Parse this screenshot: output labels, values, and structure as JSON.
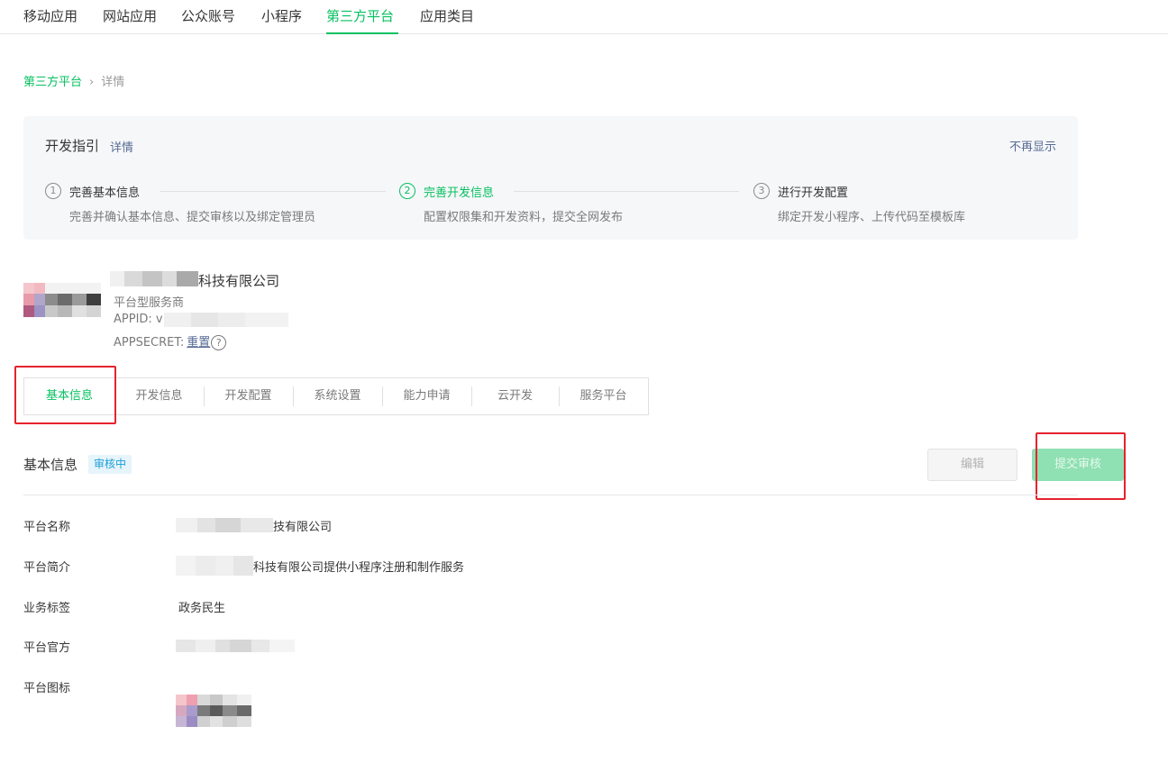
{
  "top_nav": {
    "tabs": [
      {
        "label": "移动应用",
        "active": false
      },
      {
        "label": "网站应用",
        "active": false
      },
      {
        "label": "公众账号",
        "active": false
      },
      {
        "label": "小程序",
        "active": false
      },
      {
        "label": "第三方平台",
        "active": true
      },
      {
        "label": "应用类目",
        "active": false
      }
    ]
  },
  "breadcrumb": {
    "parent": "第三方平台",
    "separator": "›",
    "current": "详情"
  },
  "guide": {
    "title": "开发指引",
    "detail_link": "详情",
    "hide_link": "不再显示",
    "steps": [
      {
        "num": "1",
        "title": "完善基本信息",
        "desc": "完善并确认基本信息、提交审核以及绑定管理员",
        "active": false
      },
      {
        "num": "2",
        "title": "完善开发信息",
        "desc": "配置权限集和开发资料，提交全网发布",
        "active": true
      },
      {
        "num": "3",
        "title": "进行开发配置",
        "desc": "绑定开发小程序、上传代码至模板库",
        "active": false
      }
    ]
  },
  "platform": {
    "name_suffix": "科技有限公司",
    "type": "平台型服务商",
    "appid_label": "APPID: v",
    "appsecret_label": "APPSECRET:",
    "reset_link": "重置",
    "help_icon_glyph": "?"
  },
  "tabs": [
    {
      "label": "基本信息",
      "active": true
    },
    {
      "label": "开发信息",
      "active": false
    },
    {
      "label": "开发配置",
      "active": false
    },
    {
      "label": "系统设置",
      "active": false
    },
    {
      "label": "能力申请",
      "active": false
    },
    {
      "label": "云开发",
      "active": false
    },
    {
      "label": "服务平台",
      "active": false
    }
  ],
  "basic_info": {
    "title": "基本信息",
    "status_badge": "审核中",
    "edit_button": "编辑",
    "submit_button": "提交审核",
    "rows": [
      {
        "label": "平台名称",
        "value": "技有限公司"
      },
      {
        "label": "平台简介",
        "value": "科技有限公司提供小程序注册和制作服务"
      },
      {
        "label": "业务标签",
        "value": "政务民生"
      },
      {
        "label": "平台官方",
        "value": ""
      },
      {
        "label": "平台图标",
        "value": ""
      }
    ]
  },
  "colors": {
    "accent": "#07c160",
    "link": "#576b95",
    "highlight_box": "#e5232e",
    "badge_text": "#1a9fd6"
  }
}
